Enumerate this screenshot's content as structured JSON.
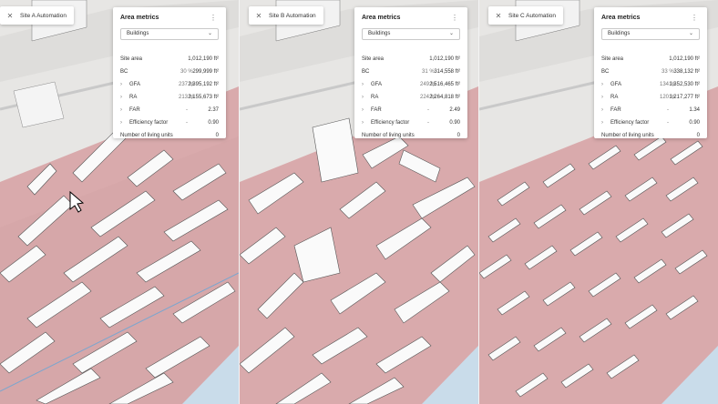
{
  "panels": [
    {
      "tab_title": "Site A Automation",
      "card": {
        "title": "Area metrics",
        "dropdown": "Buildings",
        "site_area": {
          "label": "Site area",
          "value": "1,012,190 ft²"
        },
        "bc": {
          "label": "BC",
          "pct": "30 %",
          "value": "299,999 ft²"
        },
        "gfa": {
          "label": "GFA",
          "pct": "237 %",
          "value": "2,395,192 ft²"
        },
        "ra": {
          "label": "RA",
          "pct": "213 %",
          "value": "2,155,673 ft²"
        },
        "far": {
          "label": "FAR",
          "pct": "-",
          "value": "2.37"
        },
        "eff": {
          "label": "Efficiency factor",
          "pct": "-",
          "value": "0.90"
        },
        "units": {
          "label": "Number of living units",
          "value": "0"
        }
      }
    },
    {
      "tab_title": "Site B Automation",
      "card": {
        "title": "Area metrics",
        "dropdown": "Buildings",
        "site_area": {
          "label": "Site area",
          "value": "1,012,190 ft²"
        },
        "bc": {
          "label": "BC",
          "pct": "31 %",
          "value": "314,558 ft²"
        },
        "gfa": {
          "label": "GFA",
          "pct": "249 %",
          "value": "2,516,465 ft²"
        },
        "ra": {
          "label": "RA",
          "pct": "224 %",
          "value": "2,264,818 ft²"
        },
        "far": {
          "label": "FAR",
          "pct": "-",
          "value": "2.49"
        },
        "eff": {
          "label": "Efficiency factor",
          "pct": "-",
          "value": "0.90"
        },
        "units": {
          "label": "Number of living units",
          "value": "0"
        }
      }
    },
    {
      "tab_title": "Site C Automation",
      "card": {
        "title": "Area metrics",
        "dropdown": "Buildings",
        "site_area": {
          "label": "Site area",
          "value": "1,012,190 ft²"
        },
        "bc": {
          "label": "BC",
          "pct": "33 %",
          "value": "338,132 ft²"
        },
        "gfa": {
          "label": "GFA",
          "pct": "134 %",
          "value": "1,352,530 ft²"
        },
        "ra": {
          "label": "RA",
          "pct": "120 %",
          "value": "1,217,277 ft²"
        },
        "far": {
          "label": "FAR",
          "pct": "-",
          "value": "1.34"
        },
        "eff": {
          "label": "Efficiency factor",
          "pct": "-",
          "value": "0.90"
        },
        "units": {
          "label": "Number of living units",
          "value": "0"
        }
      }
    }
  ],
  "icons": {
    "close": "close-icon",
    "menu": "more-vertical-icon",
    "dropdown": "chevron-down-icon",
    "expand": "chevron-right-icon"
  },
  "colors": {
    "site_fill": "#d8a8aa",
    "water": "#c9dcea",
    "building": "#ffffff",
    "ground": "#e6e5e3"
  }
}
